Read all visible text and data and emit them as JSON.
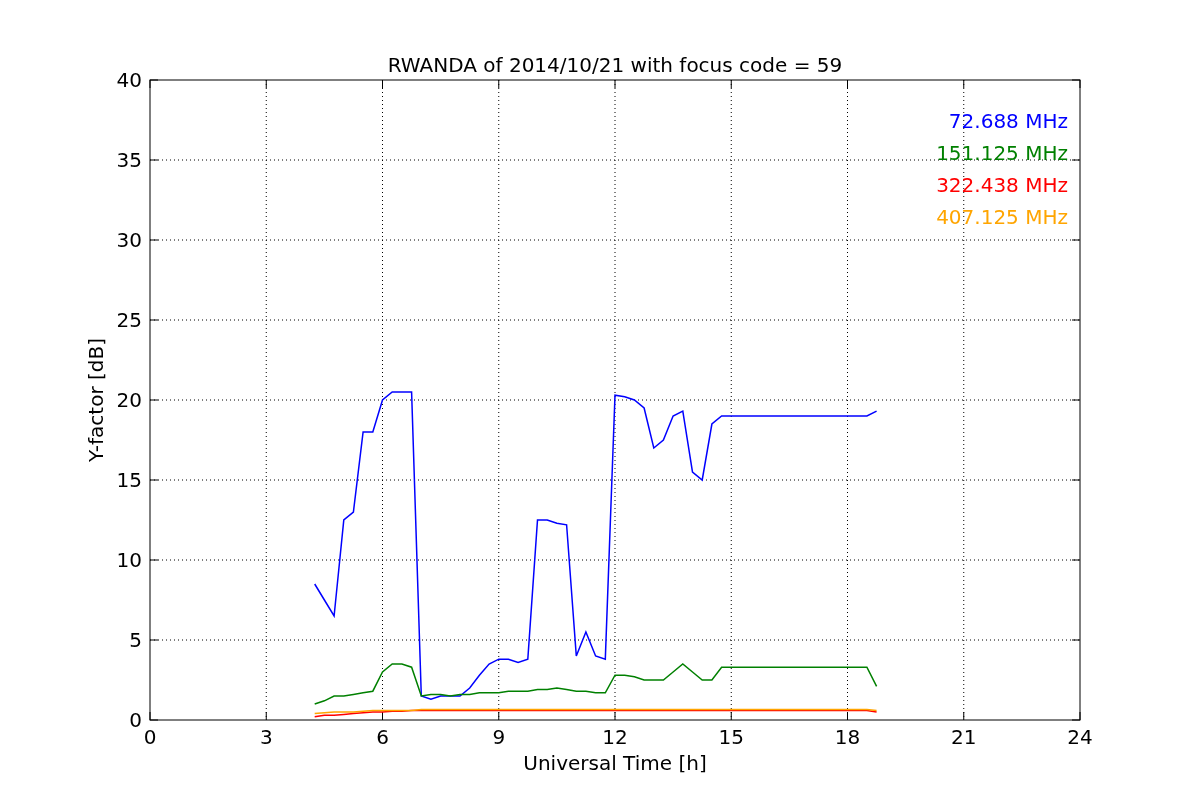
{
  "chart_data": {
    "type": "line",
    "title": "RWANDA of 2014/10/21 with focus code = 59",
    "xlabel": "Universal Time [h]",
    "ylabel": "Y-factor [dB]",
    "xlim": [
      0,
      24
    ],
    "ylim": [
      0,
      40
    ],
    "xticks": [
      0,
      3,
      6,
      9,
      12,
      15,
      18,
      21,
      24
    ],
    "yticks": [
      0,
      5,
      10,
      15,
      20,
      25,
      30,
      35,
      40
    ],
    "grid": true,
    "x": [
      4.25,
      4.5,
      4.75,
      5,
      5.25,
      5.5,
      5.75,
      6,
      6.25,
      6.5,
      6.75,
      7,
      7.25,
      7.5,
      7.75,
      8,
      8.25,
      8.5,
      8.75,
      9,
      9.25,
      9.5,
      9.75,
      10,
      10.25,
      10.5,
      10.75,
      11,
      11.25,
      11.5,
      11.75,
      12,
      12.25,
      12.5,
      12.75,
      13,
      13.25,
      13.5,
      13.75,
      14,
      14.25,
      14.5,
      14.75,
      15,
      15.25,
      15.5,
      15.75,
      16,
      16.25,
      16.5,
      16.75,
      17,
      17.25,
      17.5,
      17.75,
      18,
      18.25,
      18.5,
      18.75
    ],
    "series": [
      {
        "name": "72.688 MHz",
        "color": "#0000ff",
        "values": [
          8.5,
          7.5,
          6.5,
          12.5,
          13,
          18,
          18,
          20,
          20.5,
          20.5,
          20.5,
          1.5,
          1.3,
          1.5,
          1.5,
          1.5,
          2,
          2.8,
          3.5,
          3.8,
          3.8,
          3.6,
          3.8,
          12.5,
          12.5,
          12.3,
          12.2,
          4,
          5.5,
          4,
          3.8,
          20.3,
          20.2,
          20,
          19.5,
          17,
          17.5,
          19,
          19.3,
          15.5,
          15,
          18.5,
          19,
          19,
          19,
          19,
          19,
          19,
          19,
          19,
          19,
          19,
          19,
          19,
          19,
          19,
          19,
          19,
          19.3
        ]
      },
      {
        "name": "151.125 MHz",
        "color": "#008000",
        "values": [
          1,
          1.2,
          1.5,
          1.5,
          1.6,
          1.7,
          1.8,
          3,
          3.5,
          3.5,
          3.3,
          1.5,
          1.6,
          1.6,
          1.5,
          1.6,
          1.6,
          1.7,
          1.7,
          1.7,
          1.8,
          1.8,
          1.8,
          1.9,
          1.9,
          2,
          1.9,
          1.8,
          1.8,
          1.7,
          1.7,
          2.8,
          2.8,
          2.7,
          2.5,
          2.5,
          2.5,
          3,
          3.5,
          3,
          2.5,
          2.5,
          3.3,
          3.3,
          3.3,
          3.3,
          3.3,
          3.3,
          3.3,
          3.3,
          3.3,
          3.3,
          3.3,
          3.3,
          3.3,
          3.3,
          3.3,
          3.3,
          2.1
        ]
      },
      {
        "name": "322.438 MHz",
        "color": "#ff0000",
        "values": [
          0.2,
          0.3,
          0.3,
          0.35,
          0.4,
          0.45,
          0.5,
          0.5,
          0.55,
          0.55,
          0.6,
          0.6,
          0.6,
          0.6,
          0.6,
          0.6,
          0.6,
          0.6,
          0.6,
          0.6,
          0.6,
          0.6,
          0.6,
          0.6,
          0.6,
          0.6,
          0.6,
          0.6,
          0.6,
          0.6,
          0.6,
          0.6,
          0.6,
          0.6,
          0.6,
          0.6,
          0.6,
          0.6,
          0.6,
          0.6,
          0.6,
          0.6,
          0.6,
          0.6,
          0.6,
          0.6,
          0.6,
          0.6,
          0.6,
          0.6,
          0.6,
          0.6,
          0.6,
          0.6,
          0.6,
          0.6,
          0.6,
          0.6,
          0.5
        ]
      },
      {
        "name": "407.125 MHz",
        "color": "#ffa500",
        "values": [
          0.4,
          0.45,
          0.5,
          0.5,
          0.5,
          0.55,
          0.6,
          0.6,
          0.6,
          0.6,
          0.6,
          0.65,
          0.65,
          0.65,
          0.65,
          0.65,
          0.65,
          0.65,
          0.65,
          0.65,
          0.65,
          0.65,
          0.65,
          0.65,
          0.65,
          0.65,
          0.65,
          0.65,
          0.65,
          0.65,
          0.65,
          0.65,
          0.65,
          0.65,
          0.65,
          0.65,
          0.65,
          0.65,
          0.65,
          0.65,
          0.65,
          0.65,
          0.65,
          0.65,
          0.65,
          0.65,
          0.65,
          0.65,
          0.65,
          0.65,
          0.65,
          0.65,
          0.65,
          0.65,
          0.65,
          0.65,
          0.65,
          0.65,
          0.6
        ]
      }
    ]
  }
}
